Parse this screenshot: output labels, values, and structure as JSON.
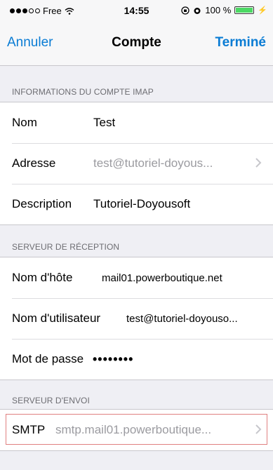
{
  "status_bar": {
    "carrier": "Free",
    "time": "14:55",
    "battery_percent_label": "100 %",
    "battery_level": 1.0
  },
  "nav": {
    "cancel_label": "Annuler",
    "title": "Compte",
    "done_label": "Terminé"
  },
  "imap_section": {
    "header": "INFORMATIONS DU COMPTE IMAP",
    "rows": [
      {
        "label": "Nom",
        "value": "Test"
      },
      {
        "label": "Adresse",
        "value": "test@tutoriel-doyous..."
      },
      {
        "label": "Description",
        "value": "Tutoriel-Doyousoft"
      }
    ]
  },
  "incoming_section": {
    "header": "SERVEUR DE RÉCEPTION",
    "rows": [
      {
        "label": "Nom d'hôte",
        "value": "mail01.powerboutique.net"
      },
      {
        "label": "Nom d'utilisateur",
        "value": "test@tutoriel-doyouso..."
      },
      {
        "label": "Mot de passe",
        "value": "••••••••"
      }
    ]
  },
  "outgoing_section": {
    "header": "SERVEUR D'ENVOI",
    "rows": [
      {
        "label": "SMTP",
        "value": "smtp.mail01.powerboutique..."
      }
    ]
  },
  "colors": {
    "accent": "#0a7cd4",
    "background": "#efeff4",
    "highlight_outline": "#e08080"
  }
}
